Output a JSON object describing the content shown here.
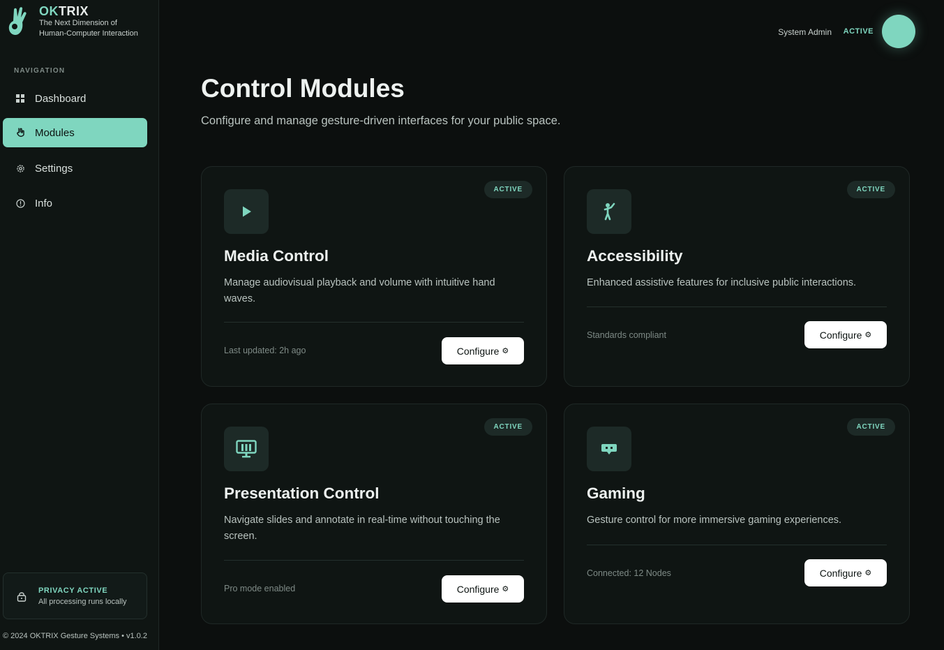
{
  "brand": {
    "name_a": "OK",
    "name_b": "TRIX",
    "tagline_1": "The Next Dimension of",
    "tagline_2": "Human-Computer Interaction"
  },
  "nav": {
    "heading": "NAVIGATION",
    "items": [
      {
        "label": "Dashboard",
        "icon": "grid-icon"
      },
      {
        "label": "Modules",
        "icon": "hand-icon",
        "active": true
      },
      {
        "label": "Settings",
        "icon": "gear-icon"
      },
      {
        "label": "Info",
        "icon": "info-icon"
      }
    ]
  },
  "privacy": {
    "title": "PRIVACY ACTIVE",
    "subtitle": "All processing runs locally"
  },
  "footer": "© 2024 OKTRIX Gesture Systems • v1.0.2",
  "header": {
    "user": "System Admin",
    "status": "ACTIVE"
  },
  "page": {
    "title": "Control Modules",
    "subtitle": "Configure and manage gesture-driven interfaces for your public space."
  },
  "modules": [
    {
      "title": "Media Control",
      "description": "Manage audiovisual playback and volume with intuitive hand waves.",
      "badge": "ACTIVE",
      "meta": "Last updated: 2h ago",
      "button": "Configure",
      "icon": "play-icon"
    },
    {
      "title": "Accessibility",
      "description": "Enhanced assistive features for inclusive public interactions.",
      "badge": "ACTIVE",
      "meta": "Standards compliant",
      "button": "Configure",
      "icon": "accessibility-icon"
    },
    {
      "title": "Presentation Control",
      "description": "Navigate slides and annotate in real-time without touching the screen.",
      "badge": "ACTIVE",
      "meta": "Pro mode enabled",
      "button": "Configure",
      "icon": "presentation-icon"
    },
    {
      "title": "Gaming",
      "description": "Gesture control for more immersive gaming experiences.",
      "badge": "ACTIVE",
      "meta": "Connected: 12 Nodes",
      "button": "Configure",
      "icon": "gamepad-icon"
    }
  ],
  "colors": {
    "accent": "#7fd6bf",
    "background": "#0c0f0e",
    "card": "#0f1513"
  }
}
